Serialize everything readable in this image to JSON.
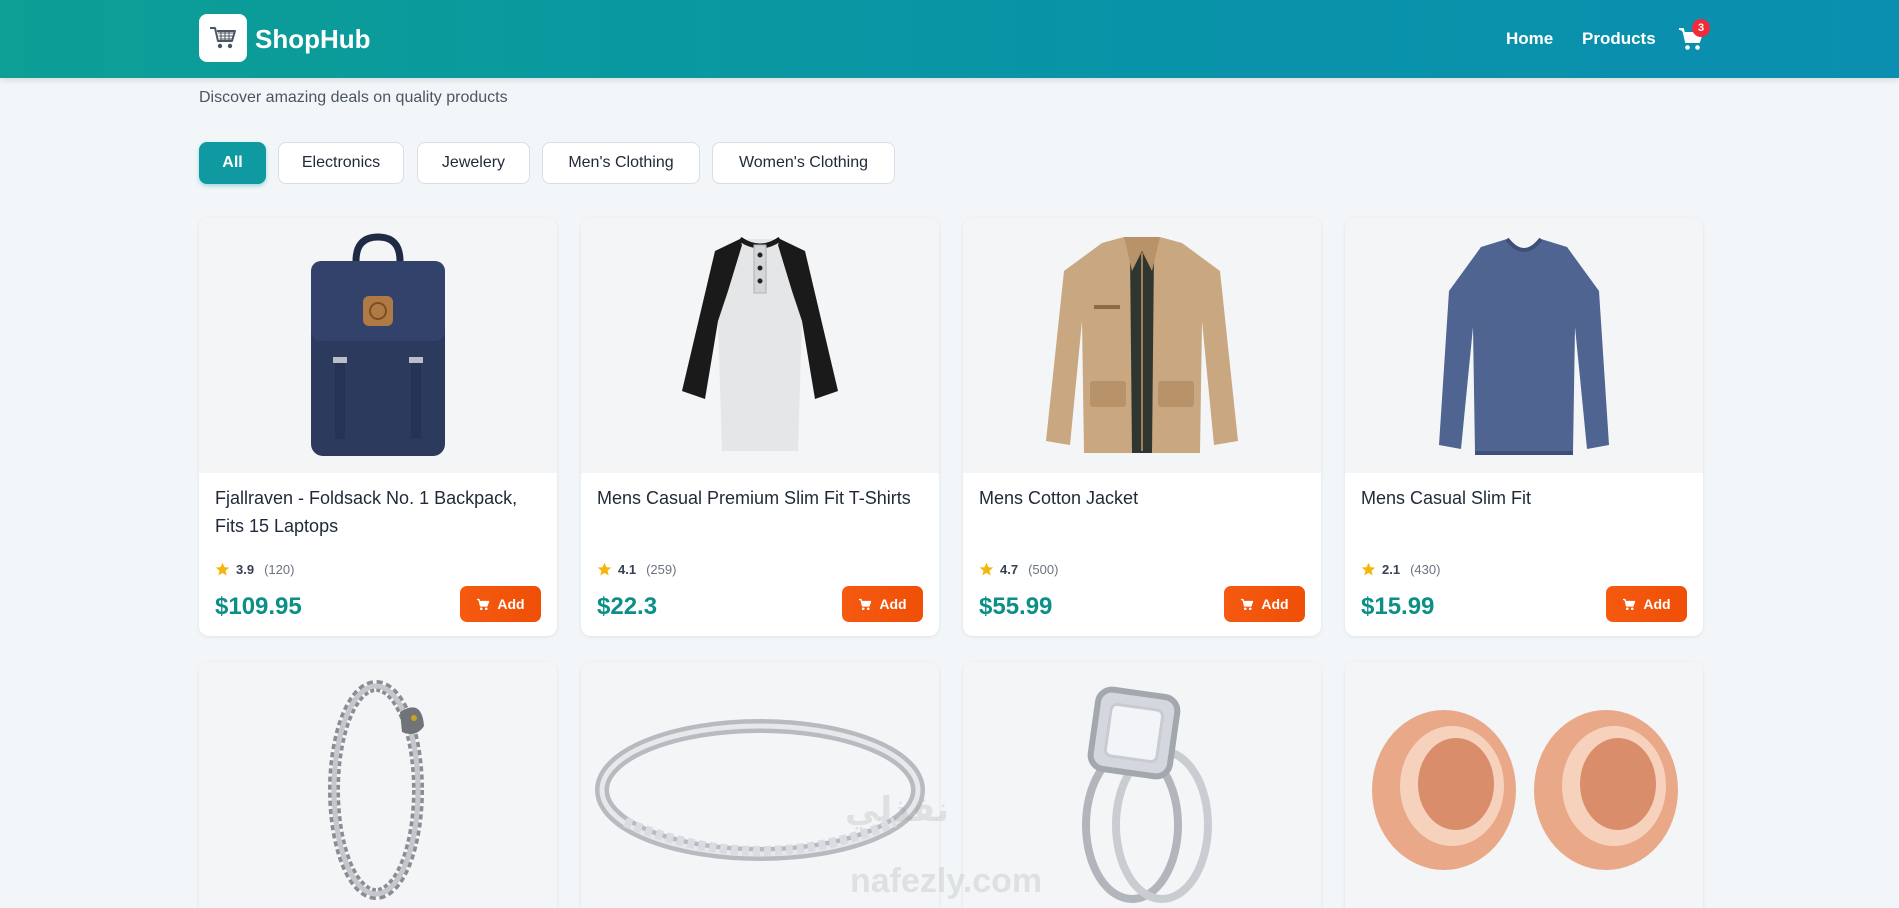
{
  "header": {
    "brand": "ShopHub",
    "nav": [
      "Home",
      "Products"
    ],
    "cart_count": "3"
  },
  "subtitle": "Discover amazing deals on quality products",
  "filters": [
    "All",
    "Electronics",
    "Jewelery",
    "Men's Clothing",
    "Women's Clothing"
  ],
  "active_filter": "All",
  "add_label": "Add",
  "products": [
    {
      "title": "Fjallraven - Foldsack No. 1 Backpack, Fits 15 Laptops",
      "rating": "3.9",
      "count": "(120)",
      "price": "$109.95",
      "image": "backpack"
    },
    {
      "title": "Mens Casual Premium Slim Fit T-Shirts",
      "rating": "4.1",
      "count": "(259)",
      "price": "$22.3",
      "image": "raglan-tshirt"
    },
    {
      "title": "Mens Cotton Jacket",
      "rating": "4.7",
      "count": "(500)",
      "price": "$55.99",
      "image": "cotton-jacket"
    },
    {
      "title": "Mens Casual Slim Fit",
      "rating": "2.1",
      "count": "(430)",
      "price": "$15.99",
      "image": "longsleeve-shirt"
    },
    {
      "title": "",
      "image": "dragon-bracelet"
    },
    {
      "title": "",
      "image": "silver-ring"
    },
    {
      "title": "",
      "image": "diamond-ring-set"
    },
    {
      "title": "",
      "image": "rose-gold-plugs"
    }
  ],
  "watermark": [
    "نفذلي",
    "nafezly.com"
  ],
  "colors": {
    "header_start": "#0c9f95",
    "header_end": "#0a8fb0",
    "accent": "#0e9aa0",
    "price": "#0b8f87",
    "add_button": "#f55a10",
    "badge": "#ef2b3a",
    "star": "#f5b50a"
  }
}
